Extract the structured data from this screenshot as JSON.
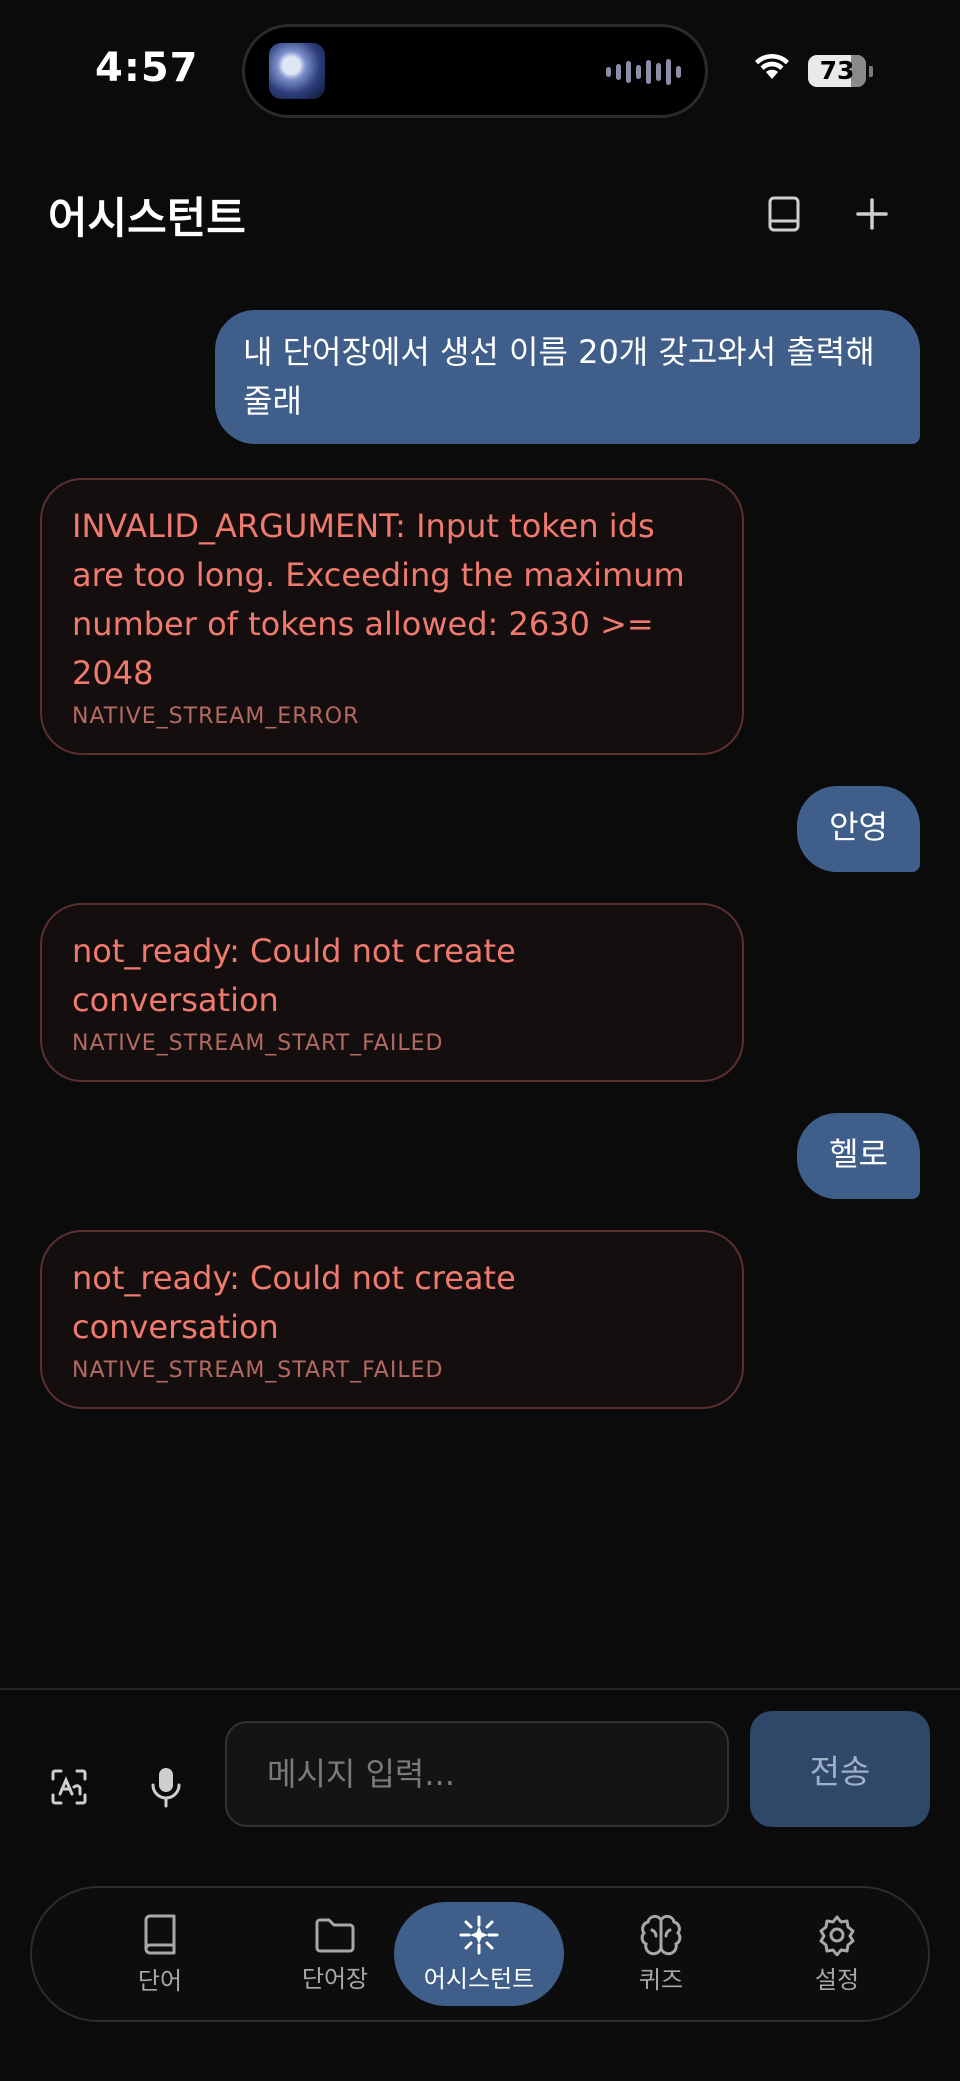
{
  "status_bar": {
    "time": "4:57",
    "battery": "73"
  },
  "header": {
    "title": "어시스턴트"
  },
  "messages": [
    {
      "role": "user",
      "text": "내 단어장에서 생선 이름 20개 갖고와서 출력해 줄래"
    },
    {
      "role": "error",
      "text": "INVALID_ARGUMENT: Input token ids are too long. Exceeding the maximum number of tokens allowed: 2630 >= 2048",
      "code": "NATIVE_STREAM_ERROR"
    },
    {
      "role": "user",
      "text": "안영"
    },
    {
      "role": "error",
      "text": "not_ready: Could not create conversation",
      "code": "NATIVE_STREAM_START_FAILED"
    },
    {
      "role": "user",
      "text": "헬로"
    },
    {
      "role": "error",
      "text": "not_ready: Could not create conversation",
      "code": "NATIVE_STREAM_START_FAILED"
    }
  ],
  "composer": {
    "placeholder": "메시지 입력...",
    "send_label": "전송"
  },
  "nav": {
    "items": [
      {
        "label": "단어",
        "icon": "book-icon"
      },
      {
        "label": "단어장",
        "icon": "folder-icon"
      },
      {
        "label": "어시스턴트",
        "icon": "sparkle-icon",
        "active": true
      },
      {
        "label": "퀴즈",
        "icon": "brain-icon"
      },
      {
        "label": "설정",
        "icon": "gear-icon"
      }
    ]
  },
  "colors": {
    "accent": "#3f5f8a",
    "error_text": "#ef7a6d",
    "background": "#0b0b0b"
  }
}
